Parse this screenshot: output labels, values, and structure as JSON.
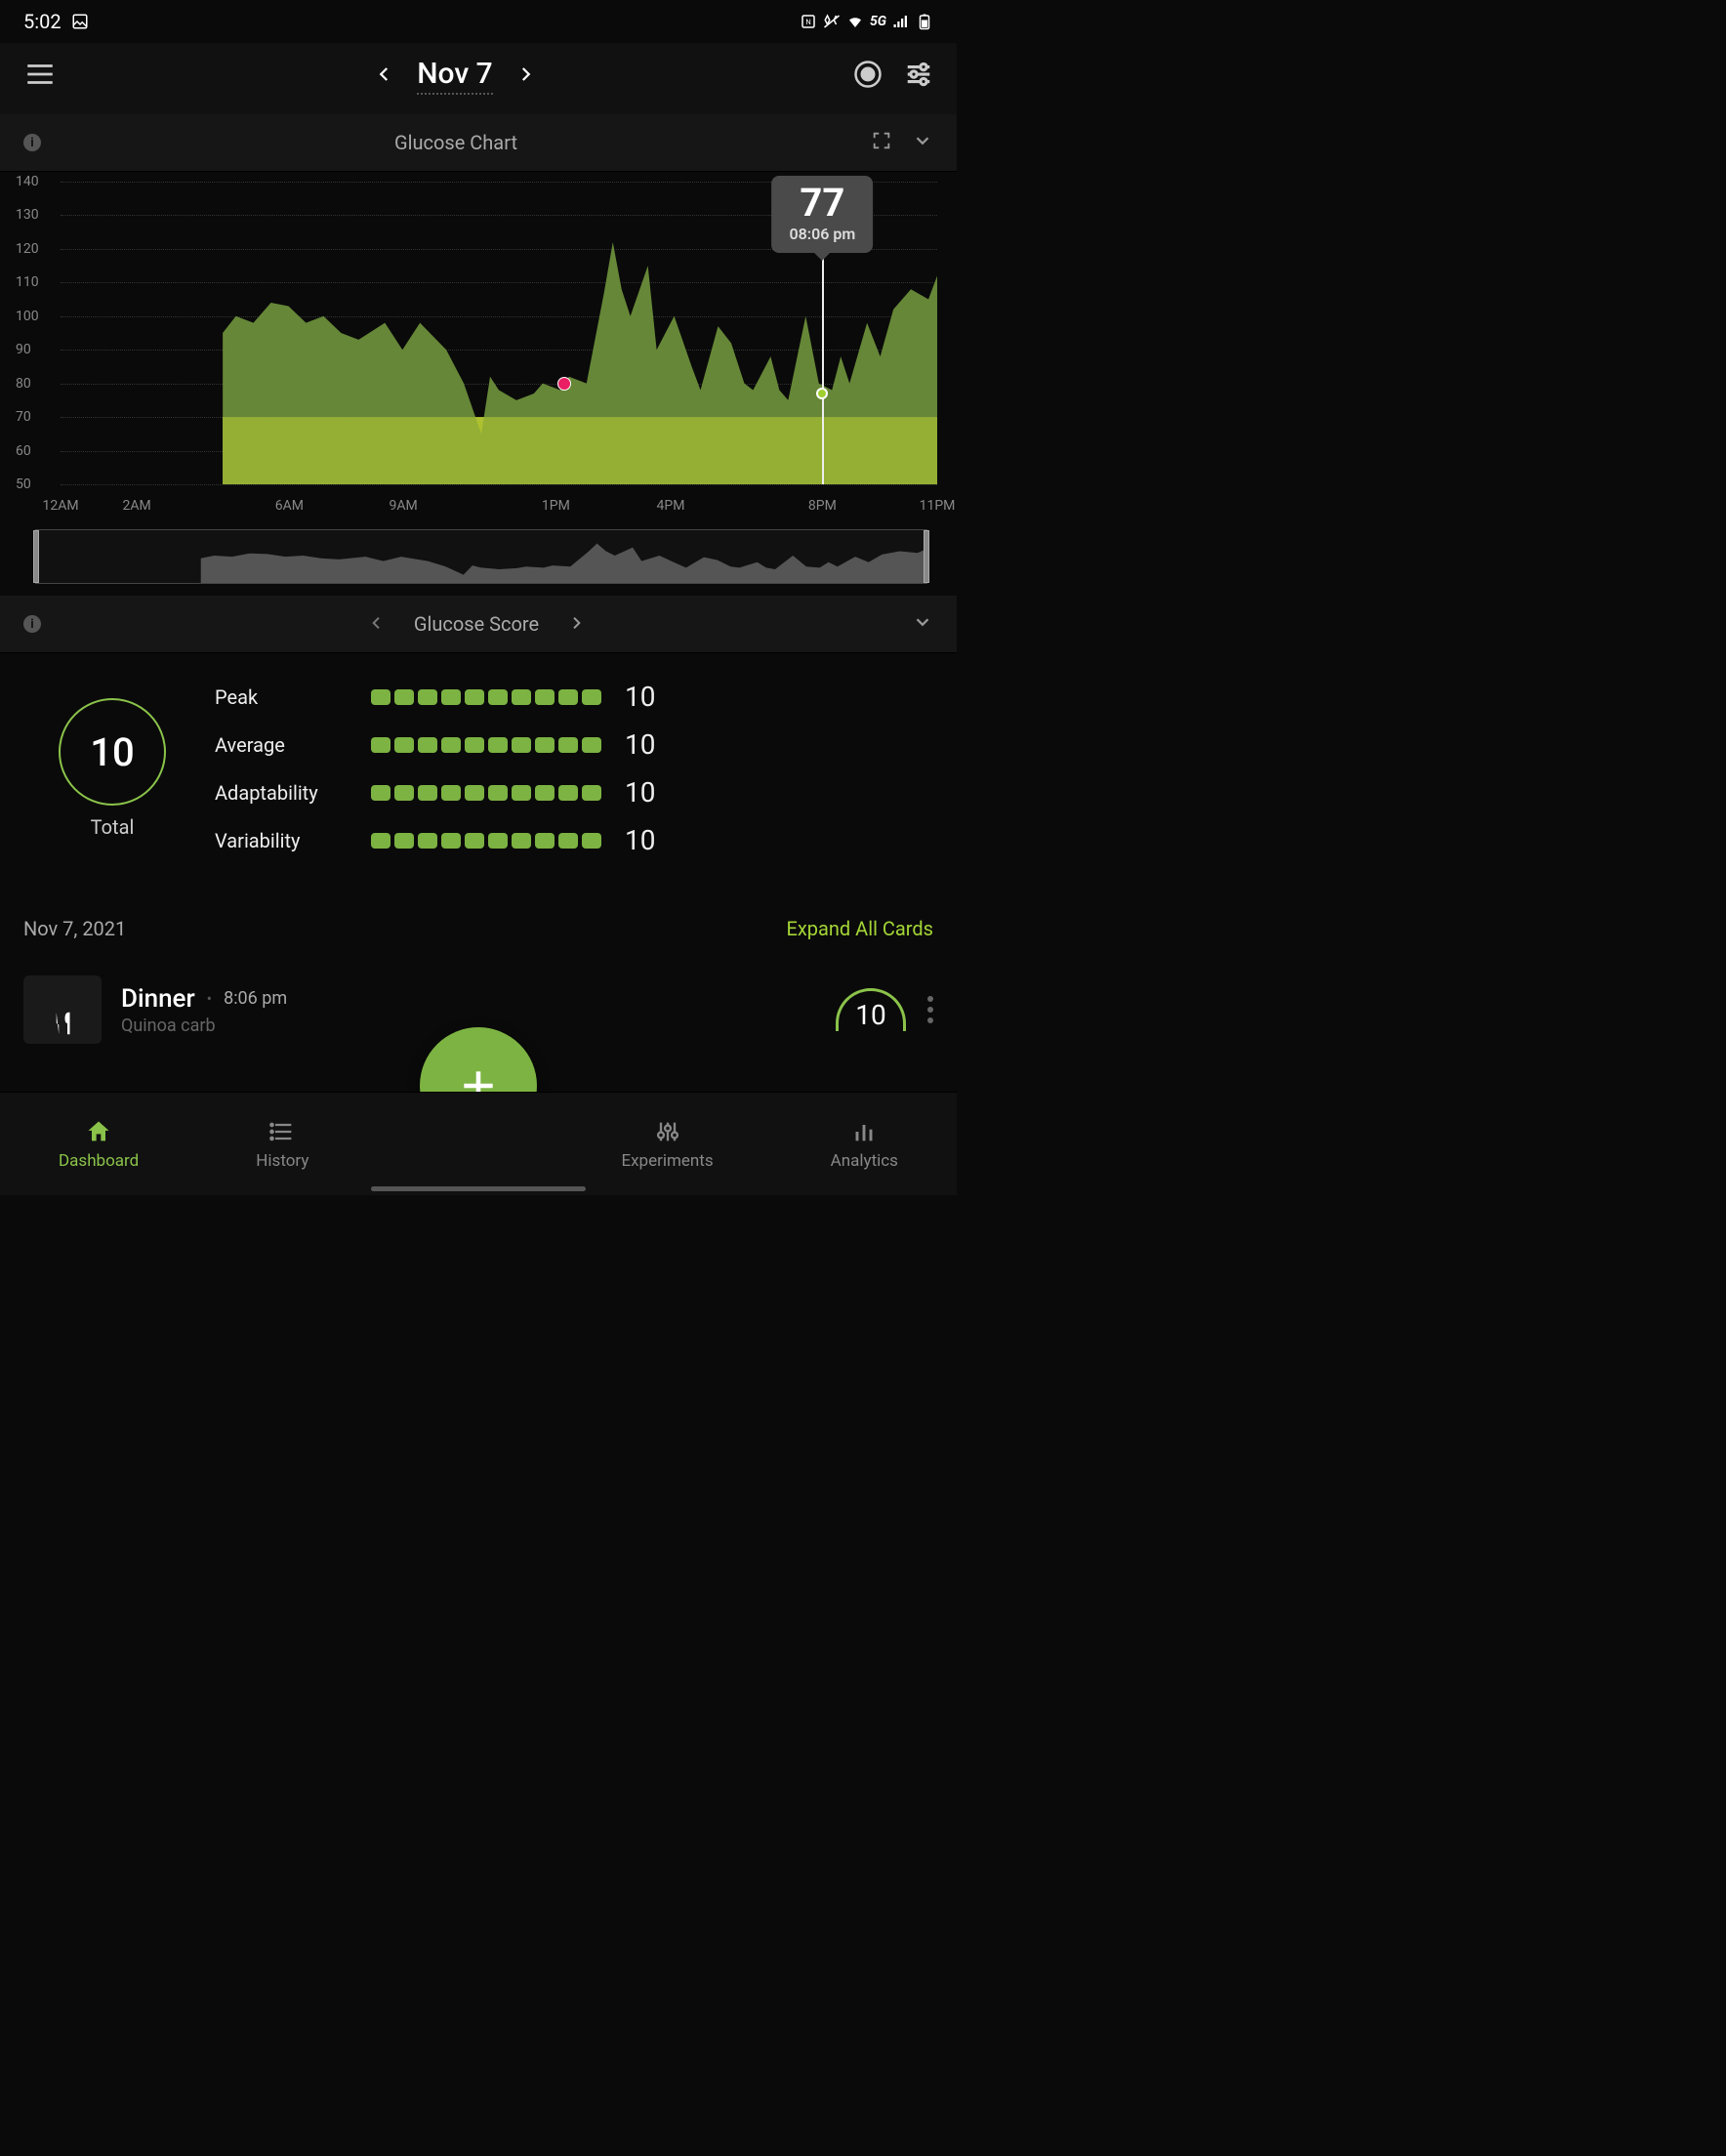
{
  "status_bar": {
    "time": "5:02",
    "network": "5G"
  },
  "header": {
    "date": "Nov 7"
  },
  "glucose_chart_header": {
    "title": "Glucose Chart"
  },
  "chart_data": {
    "type": "area",
    "title": "Glucose Chart",
    "ylabel": "",
    "xlabel": "",
    "ylim": [
      50,
      140
    ],
    "y_ticks": [
      50,
      60,
      70,
      80,
      90,
      100,
      110,
      120,
      130,
      140
    ],
    "x_ticks": [
      "12AM",
      "2AM",
      "6AM",
      "9AM",
      "1PM",
      "4PM",
      "8PM",
      "11PM"
    ],
    "x_tick_positions": [
      0,
      8.7,
      26.1,
      39.1,
      56.5,
      69.6,
      86.9,
      100
    ],
    "target_band": [
      50,
      70
    ],
    "series": [
      {
        "name": "glucose",
        "x_percent": [
          18.5,
          20,
          22,
          24,
          26,
          28,
          30,
          32,
          34,
          37,
          39,
          41,
          44,
          46,
          48,
          49,
          50,
          52,
          54,
          55,
          57,
          58,
          60,
          62,
          63,
          64,
          65,
          67,
          68,
          70,
          72,
          73,
          75,
          76.5,
          78,
          79,
          81,
          82,
          83,
          85,
          86.5,
          88,
          89,
          90,
          92,
          93.5,
          95,
          97,
          99,
          100
        ],
        "y": [
          95,
          100,
          98,
          104,
          103,
          98,
          100,
          95,
          93,
          98,
          90,
          98,
          90,
          80,
          65,
          82,
          78,
          75,
          77,
          80,
          78,
          82,
          80,
          107,
          122,
          108,
          100,
          115,
          90,
          100,
          85,
          78,
          97,
          92,
          80,
          78,
          88,
          78,
          75,
          100,
          80,
          78,
          88,
          80,
          98,
          88,
          102,
          108,
          105,
          112
        ]
      }
    ],
    "marker": {
      "x_percent": 86.9,
      "value": 77,
      "label_time": "08:06 pm"
    },
    "event_dot": {
      "x_percent": 57.5,
      "y": 80,
      "color": "#e91e63"
    }
  },
  "glucose_score_header": {
    "title": "Glucose Score"
  },
  "score": {
    "total_value": "10",
    "total_label": "Total",
    "rows": [
      {
        "name": "Peak",
        "value": "10",
        "pips": 10
      },
      {
        "name": "Average",
        "value": "10",
        "pips": 10
      },
      {
        "name": "Adaptability",
        "value": "10",
        "pips": 10
      },
      {
        "name": "Variability",
        "value": "10",
        "pips": 10
      }
    ]
  },
  "entries": {
    "date_label": "Nov 7, 2021",
    "expand_label": "Expand All Cards",
    "items": [
      {
        "title": "Dinner",
        "time": "8:06 pm",
        "subtitle": "Quinoa carb",
        "score": "10"
      }
    ]
  },
  "bottom_nav": {
    "items": [
      {
        "label": "Dashboard",
        "active": true
      },
      {
        "label": "History",
        "active": false
      },
      {
        "label": "Experiments",
        "active": false
      },
      {
        "label": "Analytics",
        "active": false
      }
    ]
  }
}
